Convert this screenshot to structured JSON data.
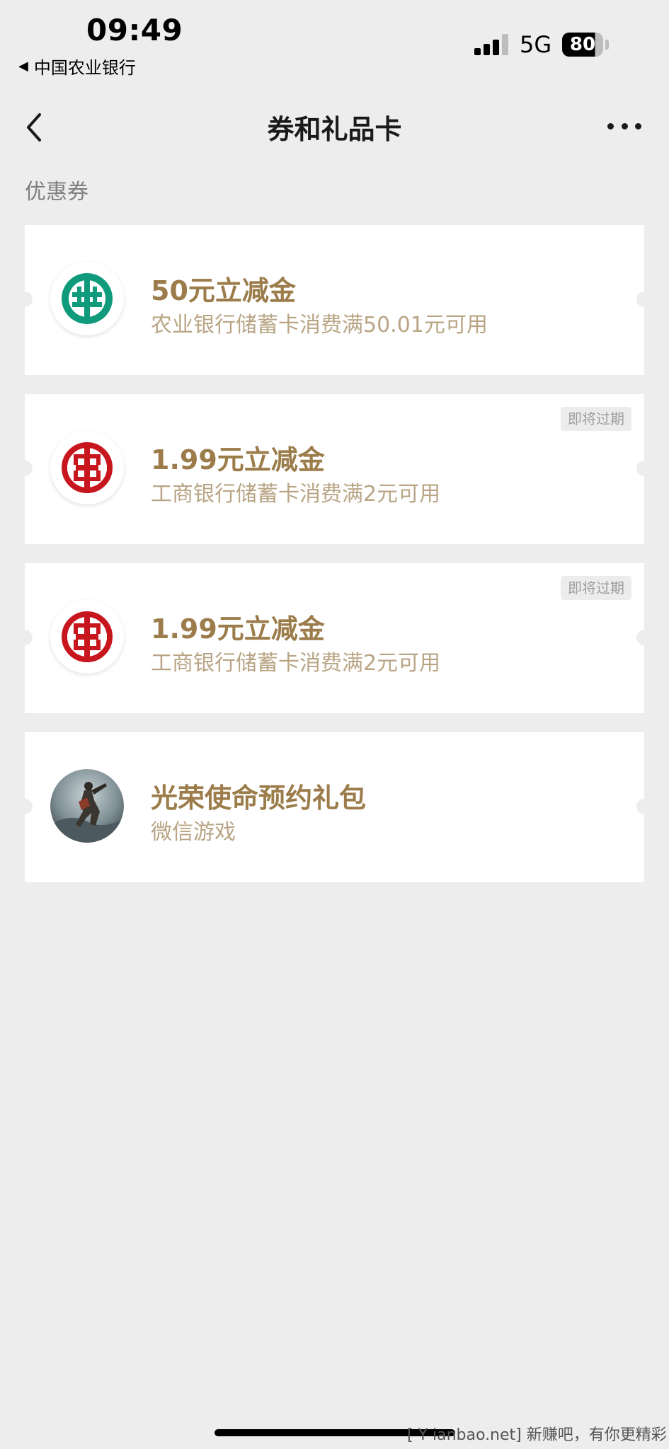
{
  "status_bar": {
    "time": "09:49",
    "back_app": "中国农业银行",
    "back_arrow": "◀",
    "network": "5G",
    "battery": "80"
  },
  "nav": {
    "title": "券和礼品卡"
  },
  "section": {
    "label": "优惠券"
  },
  "cards": [
    {
      "title": "50元立减金",
      "subtitle": "农业银行储蓄卡消费满50.01元可用",
      "logo": "abc-bank-logo",
      "logo_color": "#0f9a7b",
      "badge": ""
    },
    {
      "title": "1.99元立减金",
      "subtitle": "工商银行储蓄卡消费满2元可用",
      "logo": "icbc-logo",
      "logo_color": "#c8161e",
      "badge": "即将过期"
    },
    {
      "title": "1.99元立减金",
      "subtitle": "工商银行储蓄卡消费满2元可用",
      "logo": "icbc-logo",
      "logo_color": "#c8161e",
      "badge": "即将过期"
    },
    {
      "title": "光荣使命预约礼包",
      "subtitle": "微信游戏",
      "logo": "game-avatar",
      "badge": ""
    }
  ],
  "colors": {
    "background": "#ededed",
    "card_title": "#9b7c4a",
    "card_subtitle": "#b9a585"
  },
  "watermark": "[ Y  ianbao.net] 新赚吧，有你更精彩！"
}
